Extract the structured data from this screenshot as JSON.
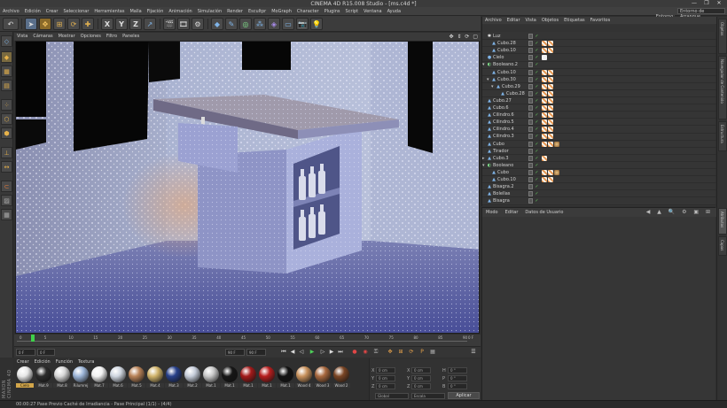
{
  "window": {
    "title": "CINEMA 4D R15.008 Studio - [ms.c4d *]",
    "controls": [
      "—",
      "❐",
      "✕"
    ]
  },
  "menubar": {
    "items": [
      "Archivo",
      "Edición",
      "Crear",
      "Seleccionar",
      "Herramientas",
      "Malla",
      "Fijación",
      "Animación",
      "Simulación",
      "Render",
      "Escultpr",
      "MoGraph",
      "Character",
      "Plugins",
      "Script",
      "Ventana",
      "Ayuda"
    ],
    "layout_label": "Entorno:",
    "layout_value": "Entorno de Arranque"
  },
  "toolbar": {
    "undo": "↶",
    "axis_x": "X",
    "axis_y": "Y",
    "axis_z": "Z"
  },
  "viewport": {
    "menu": [
      "Vista",
      "Cámaras",
      "Mostrar",
      "Opciones",
      "Filtro",
      "Paneles"
    ],
    "nav_icons": "✥ ⇕ ⟳ ▢"
  },
  "timeline": {
    "ticks": [
      "0",
      "5",
      "10",
      "15",
      "20",
      "25",
      "30",
      "35",
      "40",
      "45",
      "50",
      "55",
      "60",
      "65",
      "70",
      "75",
      "80",
      "85",
      "90"
    ],
    "current_frame_label": "0 F",
    "start_field": "0 F",
    "current_field": "0 F",
    "end_field": "90 F",
    "end_field2": "90 F",
    "end_marker": "0 F"
  },
  "materials": {
    "menu": [
      "Crear",
      "Edición",
      "Función",
      "Textura"
    ],
    "items": [
      {
        "label": "Cielo",
        "color": "#e7e7e7",
        "selected": true
      },
      {
        "label": "Mat.9",
        "color": "#2b2b2b"
      },
      {
        "label": "Mat.8",
        "color": "#d8d8d8"
      },
      {
        "label": "Rilumrej",
        "color": "#9db6d9"
      },
      {
        "label": "Mat.7",
        "color": "#f2f2f2"
      },
      {
        "label": "Mat.6",
        "color": "#cfd6e0"
      },
      {
        "label": "Mat.5",
        "color": "#b88257"
      },
      {
        "label": "Mat.4",
        "color": "#d0b36a"
      },
      {
        "label": "Mat.3",
        "color": "#27408a"
      },
      {
        "label": "Mat.2",
        "color": "#c5ccd9"
      },
      {
        "label": "Mat.1",
        "color": "#c8c8c8"
      },
      {
        "label": "Mat.1",
        "color": "#161616"
      },
      {
        "label": "Mat.1",
        "color": "#a31a1a"
      },
      {
        "label": "Mat.1",
        "color": "#b71e1e"
      },
      {
        "label": "Mat.1",
        "color": "#121212"
      },
      {
        "label": "Wood 4",
        "color": "#c8915c"
      },
      {
        "label": "Wood 3",
        "color": "#a8683e"
      },
      {
        "label": "Wood 2",
        "color": "#7a4524"
      }
    ]
  },
  "maxon": {
    "text": "MAXON CINEMA 4D"
  },
  "coords": {
    "rows": [
      {
        "a1": "X",
        "v1": "0 cm",
        "a2": "X",
        "v2": "0 cm",
        "a3": "H",
        "v3": "0 °"
      },
      {
        "a1": "Y",
        "v1": "0 cm",
        "a2": "Y",
        "v2": "0 cm",
        "a3": "P",
        "v3": "0 °"
      },
      {
        "a1": "Z",
        "v1": "0 cm",
        "a2": "Z",
        "v2": "0 cm",
        "a3": "B",
        "v3": "0 °"
      }
    ],
    "mode_select": "Global",
    "size_select": "Escala",
    "apply_label": "Aplicar"
  },
  "statusbar": {
    "text": "00:00:27  Pase Previo Caché de Irradiancia - Pase Principal (1/1) - (4/4)"
  },
  "object_manager": {
    "tabs": [
      "Archivo",
      "Editar",
      "Vista",
      "Objetos",
      "Etiquetas",
      "Favoritos"
    ],
    "objects": [
      {
        "name": "Luz",
        "depth": 0,
        "icon": "✱",
        "tags": 0
      },
      {
        "name": "Cubo.28",
        "depth": 1,
        "icon": "▲",
        "tags": 2
      },
      {
        "name": "Cubo.10",
        "depth": 1,
        "icon": "▲",
        "tags": 2
      },
      {
        "name": "Cielo",
        "depth": 0,
        "icon": "●",
        "tags": 1,
        "white": true
      },
      {
        "name": "Booleano.2",
        "depth": 0,
        "icon": "◐",
        "tags": 0,
        "expand": "−"
      },
      {
        "name": "Cubo.10",
        "depth": 1,
        "icon": "▲",
        "tags": 2
      },
      {
        "name": "Cubo.30",
        "depth": 1,
        "icon": "▲",
        "tags": 2,
        "expand": "−"
      },
      {
        "name": "Cubo.29",
        "depth": 2,
        "icon": "▲",
        "tags": 2,
        "expand": "−"
      },
      {
        "name": "Cubo.28",
        "depth": 3,
        "icon": "▲",
        "tags": 2
      },
      {
        "name": "Cubo.27",
        "depth": 0,
        "icon": "▲",
        "tags": 2
      },
      {
        "name": "Cubo.6",
        "depth": 0,
        "icon": "▲",
        "tags": 2
      },
      {
        "name": "Cilindro.6",
        "depth": 0,
        "icon": "▲",
        "tags": 2
      },
      {
        "name": "Cilindro.5",
        "depth": 0,
        "icon": "▲",
        "tags": 2
      },
      {
        "name": "Cilindro.4",
        "depth": 0,
        "icon": "▲",
        "tags": 2
      },
      {
        "name": "Cilindro.3",
        "depth": 0,
        "icon": "▲",
        "tags": 2
      },
      {
        "name": "Cubo",
        "depth": 0,
        "icon": "▲",
        "tags": 3
      },
      {
        "name": "Tirador",
        "depth": 0,
        "icon": "▲",
        "tags": 0
      },
      {
        "name": "Cubo.3",
        "depth": 0,
        "icon": "▲",
        "tags": 1,
        "expand": "+"
      },
      {
        "name": "Booleano",
        "depth": 0,
        "icon": "◐",
        "tags": 0,
        "expand": "−"
      },
      {
        "name": "Cubo",
        "depth": 1,
        "icon": "▲",
        "tags": 3
      },
      {
        "name": "Cubo.10",
        "depth": 1,
        "icon": "▲",
        "tags": 2
      },
      {
        "name": "Bisagra.2",
        "depth": 0,
        "icon": "▲",
        "tags": 0
      },
      {
        "name": "Bolellas",
        "depth": 0,
        "icon": "▲",
        "tags": 0
      },
      {
        "name": "Bisagra",
        "depth": 0,
        "icon": "▲",
        "tags": 0
      }
    ]
  },
  "attribute_manager": {
    "tabs": [
      "Modo",
      "Editar",
      "Datos de Usuario"
    ],
    "nav": "◀ ▲ 🔍 ⚙ ▣ ⊞"
  },
  "right_tabs": [
    "Objetos",
    "Navegador de Contenido",
    "Estructura",
    "Atributos",
    "Capas"
  ]
}
